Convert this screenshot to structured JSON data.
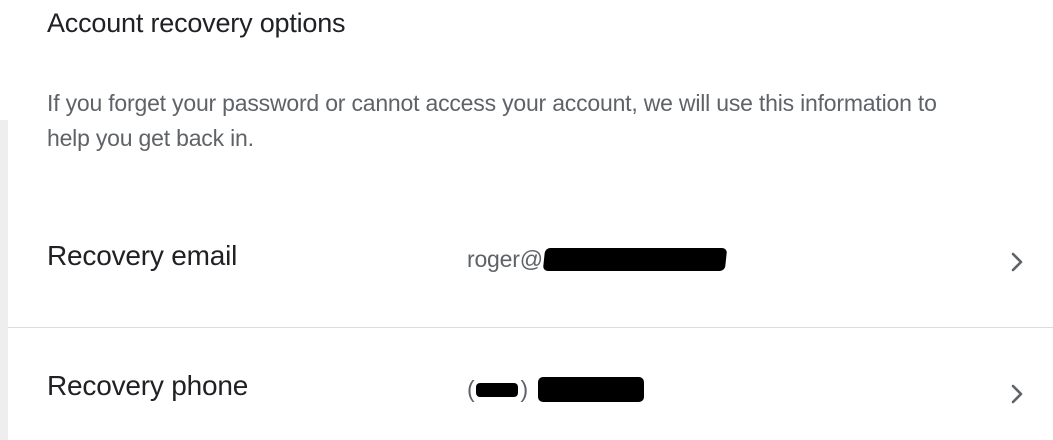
{
  "section": {
    "title": "Account recovery options",
    "description": "If you forget your password or cannot access your account, we will use this information to help you get back in."
  },
  "rows": [
    {
      "label": "Recovery email",
      "value_prefix": "roger@",
      "icon": "chevron-right-icon"
    },
    {
      "label": "Recovery phone",
      "value_open_paren": "(",
      "value_close_paren": ")",
      "icon": "chevron-right-icon"
    }
  ],
  "colors": {
    "title_text": "#202124",
    "secondary_text": "#5f6368",
    "divider": "#dadce0",
    "redaction": "#000000"
  }
}
